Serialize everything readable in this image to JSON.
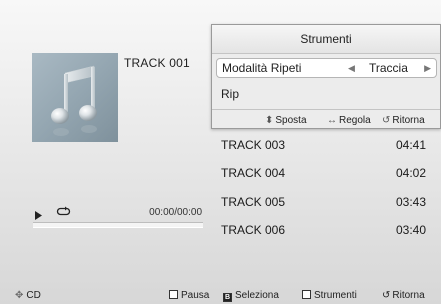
{
  "now_playing": {
    "title": "TRACK 001",
    "time": "00:00/00:00"
  },
  "tracks": [
    {
      "title": "TRACK 003",
      "duration": "04:41"
    },
    {
      "title": "TRACK 004",
      "duration": "04:02"
    },
    {
      "title": "TRACK 005",
      "duration": "03:43"
    },
    {
      "title": "TRACK 006",
      "duration": "03:40"
    }
  ],
  "tools_panel": {
    "title": "Strumenti",
    "mode_label": "Modalità Ripeti",
    "mode_value": "Traccia",
    "rip_label": "Rip",
    "hints": {
      "move": "Sposta",
      "adjust": "Regola",
      "back": "Ritorna"
    }
  },
  "bottom_bar": {
    "source": "CD",
    "pause": "Pausa",
    "select": "Seleziona",
    "tools": "Strumenti",
    "back": "Ritorna"
  },
  "icons": {
    "album_art": "music-note-icon",
    "play": "play-icon",
    "repeat": "repeat-icon"
  },
  "colors": {
    "panel_bg": "#ececec",
    "selected_row_bg": "#ffffff",
    "progress_bg": "#f4f4f4"
  }
}
